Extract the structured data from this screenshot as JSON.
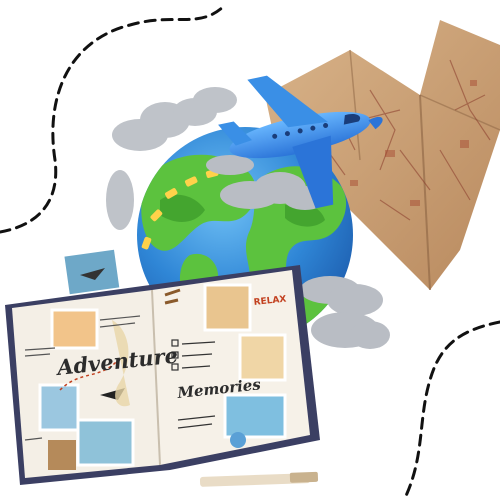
{
  "scrapbook": {
    "word_adventure": "Adventure",
    "word_memories": "Memories",
    "word_relax": "RELAX"
  },
  "colors": {
    "ocean": "#2f86d6",
    "land": "#5cc23e",
    "plane": "#3a8fe6",
    "map_paper": "#c9a27a",
    "book_cover": "#3b3f63",
    "page": "#f4efe6",
    "dashed_path": "#111111"
  },
  "icons": [
    "globe-icon",
    "airplane-icon",
    "cloud-icon",
    "origami-map-heart",
    "scrapbook",
    "pen-icon",
    "dashed-route"
  ]
}
